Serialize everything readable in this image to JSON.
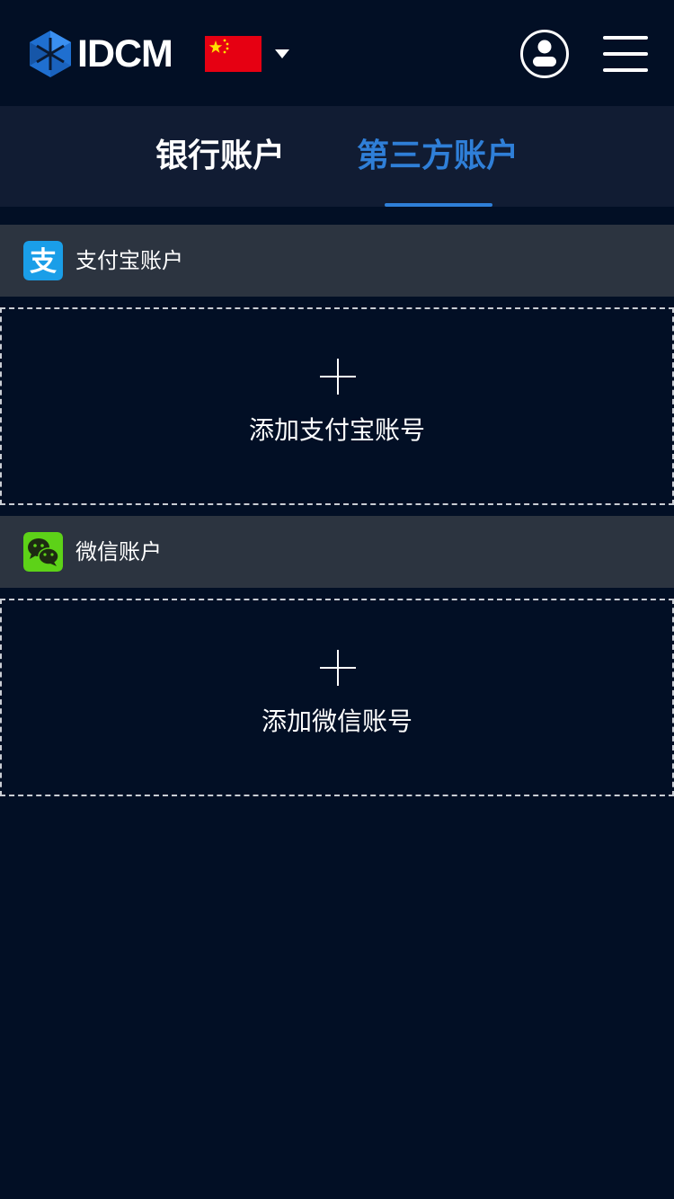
{
  "header": {
    "brand": "IDCM",
    "logo_icon": "idcm-cube-logo-icon",
    "region_icon": "china-flag-icon",
    "user_icon": "user-icon",
    "menu_icon": "hamburger-menu-icon"
  },
  "tabs": [
    {
      "label": "银行账户",
      "active": false
    },
    {
      "label": "第三方账户",
      "active": true
    }
  ],
  "sections": [
    {
      "title": "支付宝账户",
      "icon": "alipay-icon",
      "add_label": "添加支付宝账号"
    },
    {
      "title": "微信账户",
      "icon": "wechat-icon",
      "add_label": "添加微信账号"
    }
  ],
  "colors": {
    "background": "#020f25",
    "tab_bar": "#111c33",
    "section_header": "#2c3440",
    "accent": "#2f7fd8",
    "alipay": "#1a9ee8",
    "wechat": "#5dd218"
  }
}
